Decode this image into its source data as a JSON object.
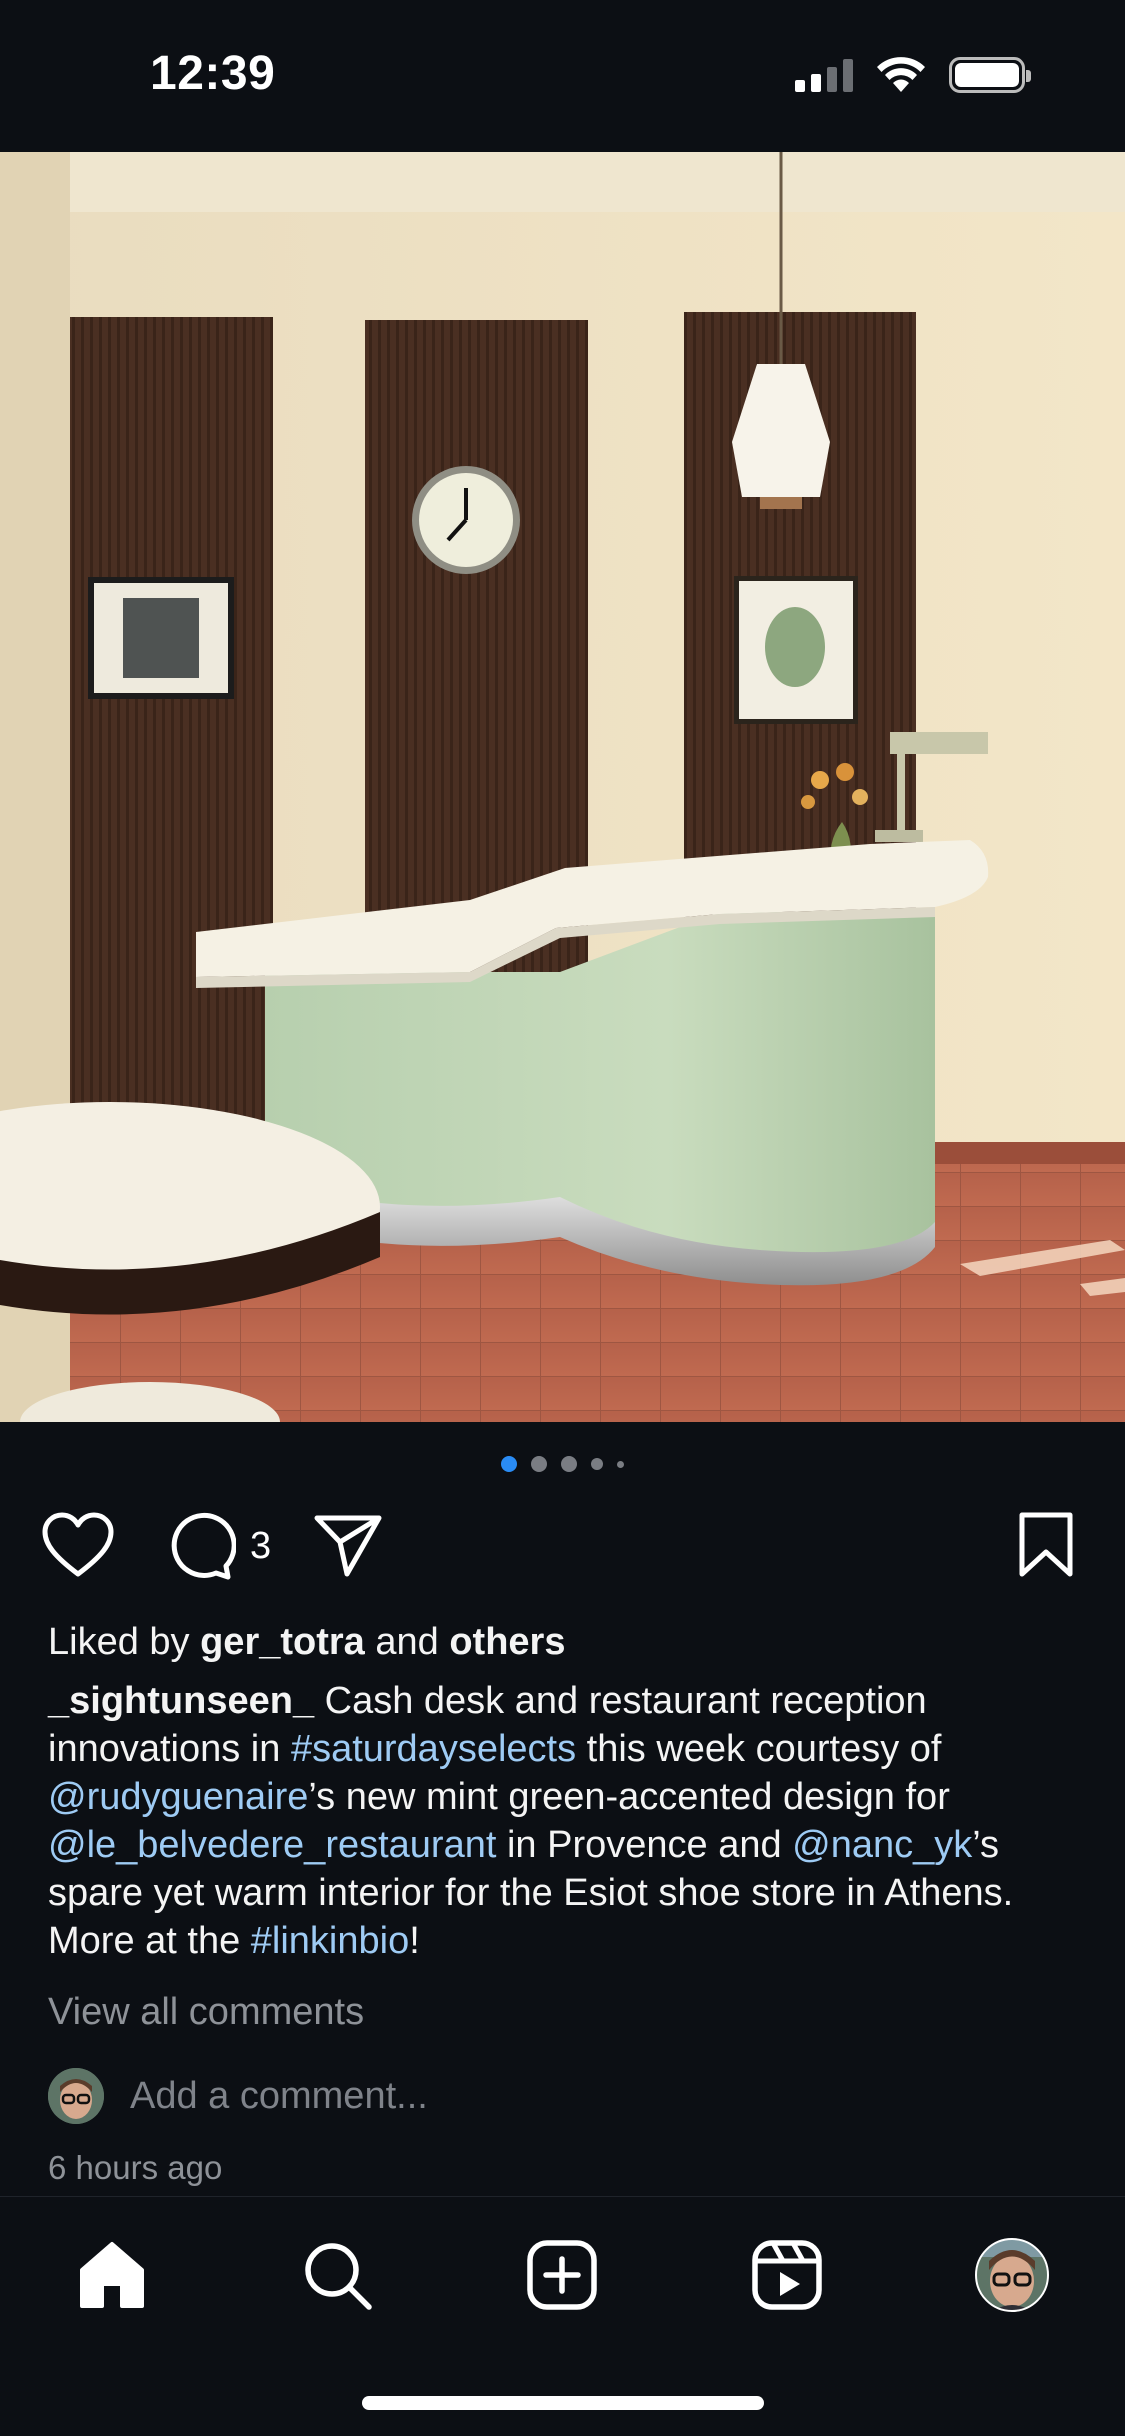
{
  "status_bar": {
    "time": "12:39"
  },
  "post": {
    "carousel": {
      "total_dots": 5,
      "active_index": 0
    },
    "comment_count": "3",
    "liked_by": {
      "prefix": "Liked by ",
      "user": "ger_totra",
      "middle": " and ",
      "others": "others"
    },
    "caption": {
      "username": "_sightunseen_",
      "segments": [
        {
          "text": " Cash desk and restaurant reception innovations in ",
          "link": false
        },
        {
          "text": "#saturdayselects",
          "link": true
        },
        {
          "text": " this week courtesy of ",
          "link": false
        },
        {
          "text": "@rudyguenaire",
          "link": true
        },
        {
          "text": "’s new mint green-accented design for ",
          "link": false
        },
        {
          "text": "@le_belvedere_restaurant",
          "link": true
        },
        {
          "text": " in Provence and ",
          "link": false
        },
        {
          "text": "@nanc_yk",
          "link": true
        },
        {
          "text": "’s spare yet warm interior for the Esiot shoe store in Athens. More at the ",
          "link": false
        },
        {
          "text": "#linkinbio",
          "link": true
        },
        {
          "text": "!",
          "link": false
        }
      ]
    },
    "view_all_comments": "View all comments",
    "add_comment_placeholder": "Add a comment...",
    "timestamp": "6 hours ago"
  },
  "nav": {
    "items": [
      "home-icon",
      "search-icon",
      "create-icon",
      "reels-icon",
      "profile-avatar"
    ]
  },
  "colors": {
    "background": "#0c0f14",
    "link": "#9ecbf4",
    "active_dot": "#2a8cf5",
    "muted_text": "#8e9298"
  }
}
